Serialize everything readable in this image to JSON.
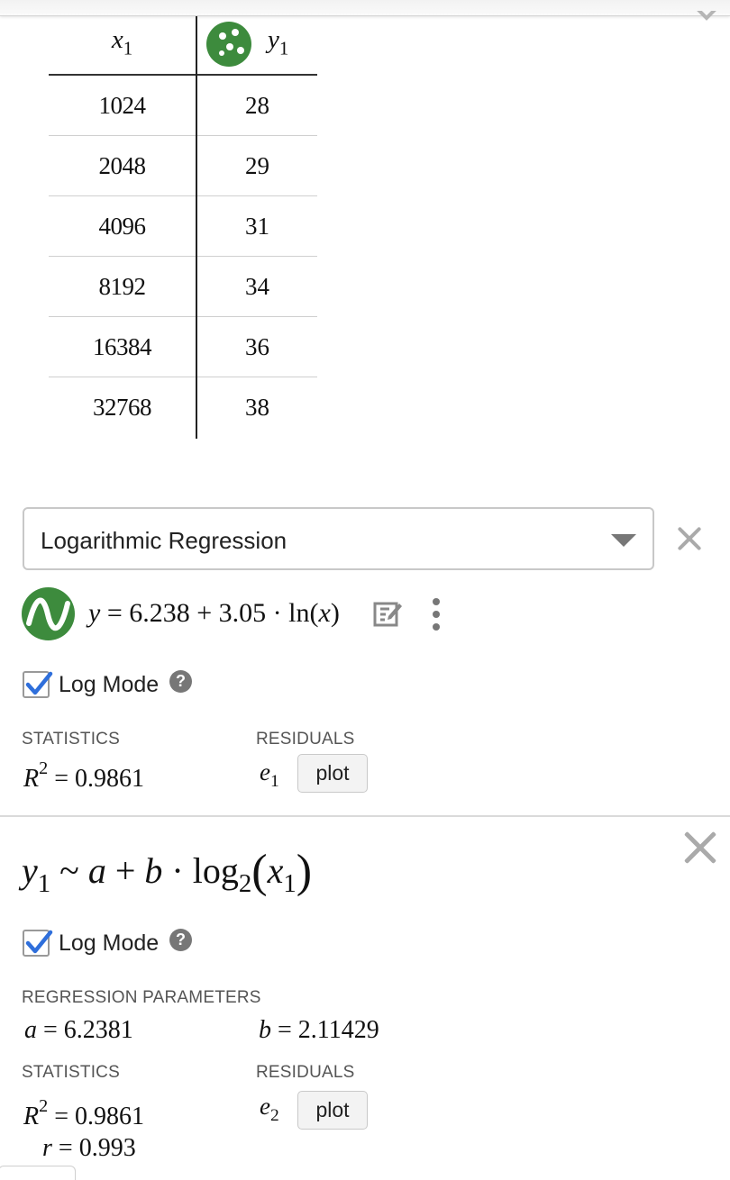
{
  "table": {
    "x_header": {
      "var": "x",
      "sub": "1"
    },
    "y_header": {
      "var": "y",
      "sub": "1"
    },
    "rows": [
      {
        "x": "1024",
        "y": "28"
      },
      {
        "x": "2048",
        "y": "29"
      },
      {
        "x": "4096",
        "y": "31"
      },
      {
        "x": "8192",
        "y": "34"
      },
      {
        "x": "16384",
        "y": "36"
      },
      {
        "x": "32768",
        "y": "38"
      }
    ]
  },
  "regression": {
    "selected": "Logarithmic Regression",
    "equation": {
      "y": "y",
      "eq": "=",
      "a": "6.238",
      "plus": "+",
      "b": "3.05",
      "dot": "·",
      "fn": "ln",
      "lp": "(",
      "arg": "x",
      "rp": ")"
    },
    "log_mode_label": "Log Mode",
    "log_mode_checked": true,
    "statistics_label": "STATISTICS",
    "residuals_label": "RESIDUALS",
    "r2": {
      "var": "R",
      "exp": "2",
      "eq": "=",
      "value": "0.9861"
    },
    "residual": {
      "var": "e",
      "sub": "1"
    },
    "plot_label": "plot"
  },
  "expression2": {
    "formula": {
      "y": "y",
      "ysub": "1",
      "tilde": "~",
      "a": "a",
      "plus": "+",
      "b": "b",
      "dot": "·",
      "fn": "log",
      "base": "2",
      "lp": "(",
      "x": "x",
      "xsub": "1",
      "rp": ")"
    },
    "log_mode_label": "Log Mode",
    "log_mode_checked": true,
    "params_label": "REGRESSION PARAMETERS",
    "a": {
      "var": "a",
      "eq": "=",
      "value": "6.2381"
    },
    "b": {
      "var": "b",
      "eq": "=",
      "value": "2.11429"
    },
    "statistics_label": "STATISTICS",
    "residuals_label": "RESIDUALS",
    "r2": {
      "var": "R",
      "exp": "2",
      "eq": "=",
      "value": "0.9861"
    },
    "r": {
      "var": "r",
      "eq": "=",
      "value": "0.993"
    },
    "residual": {
      "var": "e",
      "sub": "2"
    },
    "plot_label": "plot"
  },
  "icons": {
    "point": "scatter-points-icon",
    "model": "regression-wave-icon",
    "edit": "edit-table-icon",
    "more": "more-vertical-icon",
    "help": "help-icon",
    "close": "close-icon"
  },
  "colors": {
    "accent_green": "#3d8b3d",
    "checkbox_blue": "#2f6fdb",
    "muted_gray": "#aaaaaa"
  }
}
